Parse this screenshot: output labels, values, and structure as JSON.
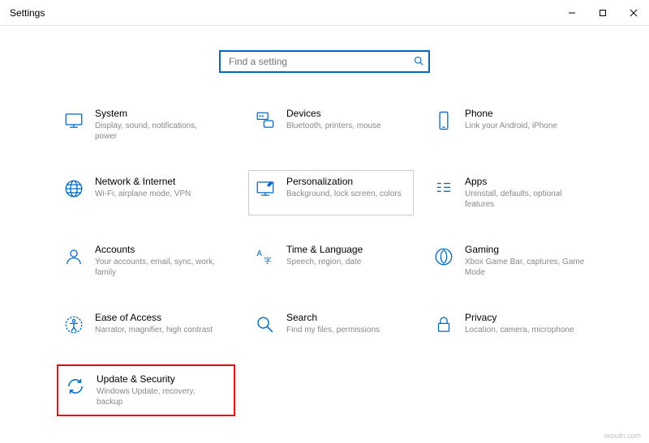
{
  "window": {
    "title": "Settings"
  },
  "search": {
    "placeholder": "Find a setting"
  },
  "tiles": {
    "system": {
      "title": "System",
      "desc": "Display, sound, notifications, power"
    },
    "devices": {
      "title": "Devices",
      "desc": "Bluetooth, printers, mouse"
    },
    "phone": {
      "title": "Phone",
      "desc": "Link your Android, iPhone"
    },
    "network": {
      "title": "Network & Internet",
      "desc": "Wi-Fi, airplane mode, VPN"
    },
    "personalization": {
      "title": "Personalization",
      "desc": "Background, lock screen, colors"
    },
    "apps": {
      "title": "Apps",
      "desc": "Uninstall, defaults, optional features"
    },
    "accounts": {
      "title": "Accounts",
      "desc": "Your accounts, email, sync, work, family"
    },
    "time": {
      "title": "Time & Language",
      "desc": "Speech, region, date"
    },
    "gaming": {
      "title": "Gaming",
      "desc": "Xbox Game Bar, captures, Game Mode"
    },
    "ease": {
      "title": "Ease of Access",
      "desc": "Narrator, magnifier, high contrast"
    },
    "search_tile": {
      "title": "Search",
      "desc": "Find my files, permissions"
    },
    "privacy": {
      "title": "Privacy",
      "desc": "Location, camera, microphone"
    },
    "update": {
      "title": "Update & Security",
      "desc": "Windows Update, recovery, backup"
    }
  },
  "watermark": "wsxdn.com"
}
